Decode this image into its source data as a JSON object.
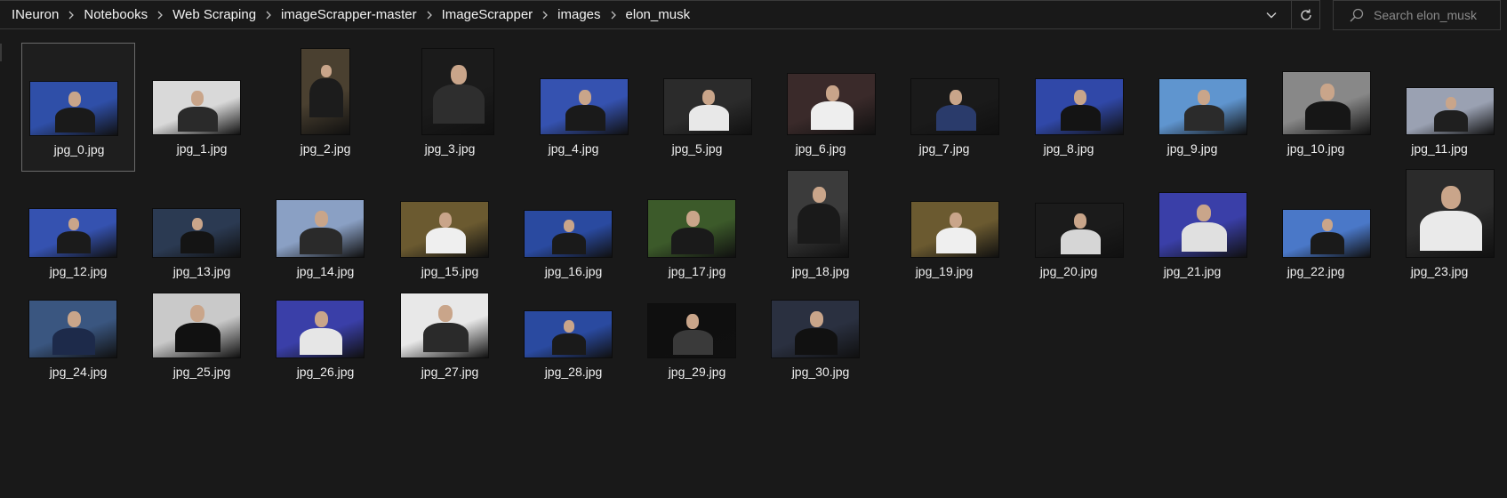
{
  "address_bar": {
    "breadcrumbs": [
      "INeuron",
      "Notebooks",
      "Web Scraping",
      "imageScrapper-master",
      "ImageScrapper",
      "images",
      "elon_musk"
    ]
  },
  "search": {
    "placeholder": "Search elon_musk"
  },
  "icons": {
    "breadcrumb_separator": "chevron-right-icon",
    "dropdown": "chevron-down-icon",
    "refresh": "refresh-icon",
    "search": "search-icon"
  },
  "colors": {
    "background": "#191919",
    "text": "#f0f0f0",
    "border": "#3a3a3a",
    "selection_border": "#6a6a6a"
  },
  "selected_file": "jpg_0.jpg",
  "files": [
    "jpg_0.jpg",
    "jpg_1.jpg",
    "jpg_2.jpg",
    "jpg_3.jpg",
    "jpg_4.jpg",
    "jpg_5.jpg",
    "jpg_6.jpg",
    "jpg_7.jpg",
    "jpg_8.jpg",
    "jpg_9.jpg",
    "jpg_10.jpg",
    "jpg_11.jpg",
    "jpg_12.jpg",
    "jpg_13.jpg",
    "jpg_14.jpg",
    "jpg_15.jpg",
    "jpg_16.jpg",
    "jpg_17.jpg",
    "jpg_18.jpg",
    "jpg_19.jpg",
    "jpg_20.jpg",
    "jpg_21.jpg",
    "jpg_22.jpg",
    "jpg_23.jpg",
    "jpg_24.jpg",
    "jpg_25.jpg",
    "jpg_26.jpg",
    "jpg_27.jpg",
    "jpg_28.jpg",
    "jpg_29.jpg",
    "jpg_30.jpg"
  ]
}
